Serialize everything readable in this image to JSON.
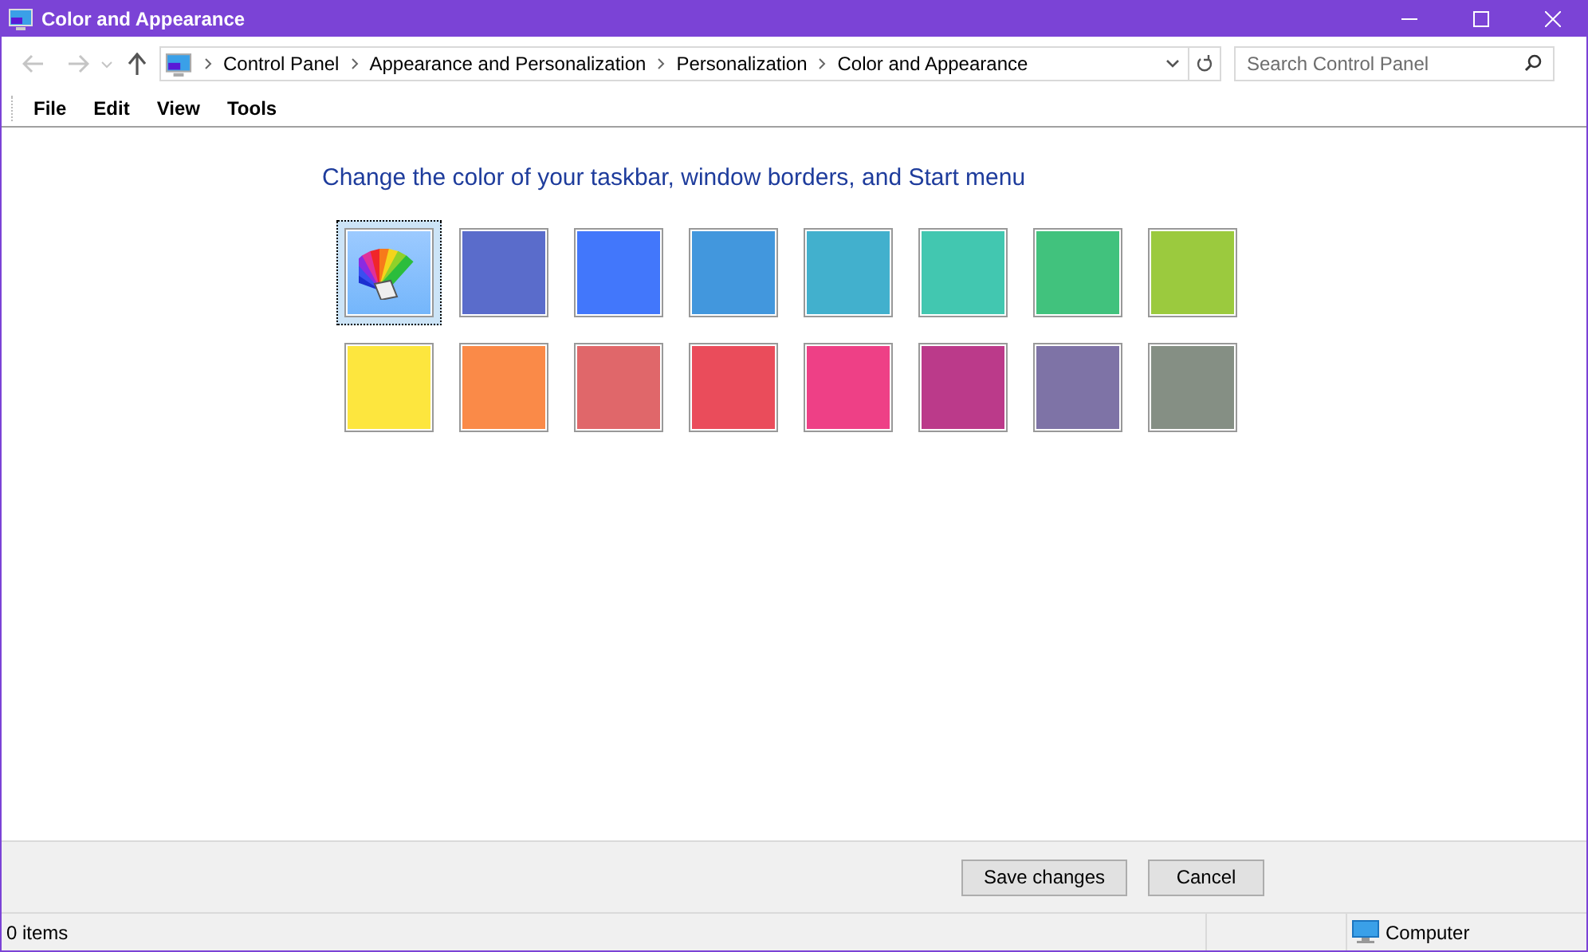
{
  "window": {
    "title": "Color and Appearance"
  },
  "address_bar": {
    "breadcrumbs": [
      "Control Panel",
      "Appearance and Personalization",
      "Personalization",
      "Color and Appearance"
    ]
  },
  "search": {
    "placeholder": "Search Control Panel"
  },
  "menu": [
    "File",
    "Edit",
    "View",
    "Tools"
  ],
  "heading": "Change the color of your taskbar, window borders, and Start menu",
  "swatches": [
    {
      "kind": "custom",
      "selected": true
    },
    {
      "kind": "color",
      "color": "#5a6ccb",
      "selected": false
    },
    {
      "kind": "color",
      "color": "#4277fb",
      "selected": false
    },
    {
      "kind": "color",
      "color": "#4297dd",
      "selected": false
    },
    {
      "kind": "color",
      "color": "#42b0cd",
      "selected": false
    },
    {
      "kind": "color",
      "color": "#42c7b0",
      "selected": false
    },
    {
      "kind": "color",
      "color": "#41c27d",
      "selected": false
    },
    {
      "kind": "color",
      "color": "#9bca3e",
      "selected": false
    },
    {
      "kind": "color",
      "color": "#fde63e",
      "selected": false
    },
    {
      "kind": "color",
      "color": "#fa8a48",
      "selected": false
    },
    {
      "kind": "color",
      "color": "#e0676a",
      "selected": false
    },
    {
      "kind": "color",
      "color": "#ea4c5b",
      "selected": false
    },
    {
      "kind": "color",
      "color": "#ee4086",
      "selected": false
    },
    {
      "kind": "color",
      "color": "#bb3a8a",
      "selected": false
    },
    {
      "kind": "color",
      "color": "#7e73a6",
      "selected": false
    },
    {
      "kind": "color",
      "color": "#858f84",
      "selected": false
    }
  ],
  "buttons": [
    "Save changes",
    "Cancel"
  ],
  "status_bar": {
    "items": "0 items",
    "location": "Computer"
  }
}
